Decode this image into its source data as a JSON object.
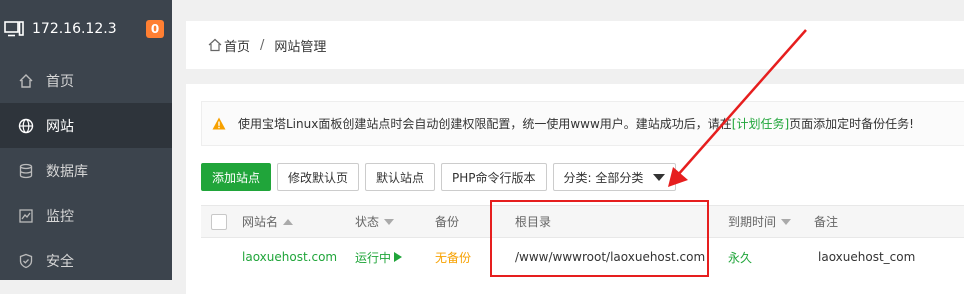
{
  "sidebar": {
    "ip": "172.16.12.3",
    "badge": "0",
    "items": [
      {
        "label": "首页",
        "icon": "home-icon"
      },
      {
        "label": "网站",
        "icon": "globe-icon"
      },
      {
        "label": "数据库",
        "icon": "database-icon"
      },
      {
        "label": "监控",
        "icon": "monitor-icon"
      },
      {
        "label": "安全",
        "icon": "shield-icon"
      }
    ]
  },
  "breadcrumb": {
    "home": "首页",
    "separator": "/",
    "current": "网站管理"
  },
  "notice": {
    "text_before": "使用宝塔Linux面板创建站点时会自动创建权限配置，统一使用www用户。建站成功后，请在",
    "link": "[计划任务]",
    "text_after": "页面添加定时备份任务!"
  },
  "toolbar": {
    "add_site": "添加站点",
    "edit_default_page": "修改默认页",
    "default_site": "默认站点",
    "php_version": "PHP命令行版本",
    "category": "分类: 全部分类"
  },
  "table": {
    "columns": [
      "网站名",
      "状态",
      "备份",
      "根目录",
      "到期时间",
      "备注"
    ],
    "rows": [
      {
        "name": "laoxuehost.com",
        "status": "运行中",
        "backup": "无备份",
        "root": "/www/wwwroot/laoxuehost.com",
        "expiry": "永久",
        "remark": "laoxuehost_com"
      }
    ]
  },
  "colors": {
    "accent": "#20a53a",
    "annotation": "#e61e1e",
    "sidebar": "#3c444d",
    "warning": "#f7a100"
  }
}
